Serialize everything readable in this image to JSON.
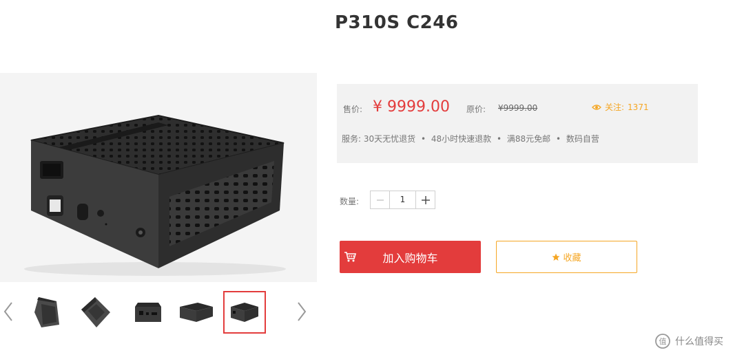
{
  "product": {
    "title": "P310S C246"
  },
  "price_box": {
    "sale_label": "售价:",
    "sale_price": "¥ 9999.00",
    "orig_label": "原价:",
    "orig_price": "¥9999.00",
    "follow_label": "关注:",
    "follow_count": "1371",
    "service_label": "服务:",
    "services": [
      "30天无忧退货",
      "48小时快速退款",
      "满88元免邮",
      "数码自营"
    ]
  },
  "quantity": {
    "label": "数量:",
    "value": "1"
  },
  "buttons": {
    "add_to_cart": "加入购物车",
    "favorite": "收藏"
  },
  "gallery": {
    "thumbnails": [
      "case-angle-1",
      "case-angle-2",
      "case-front",
      "case-side",
      "case-back"
    ],
    "selected_index": 4
  },
  "watermark": {
    "text": "什么值得买"
  },
  "colors": {
    "accent_red": "#e33c3c",
    "accent_orange": "#f5a623",
    "price_box_bg": "#f2f2f2"
  }
}
